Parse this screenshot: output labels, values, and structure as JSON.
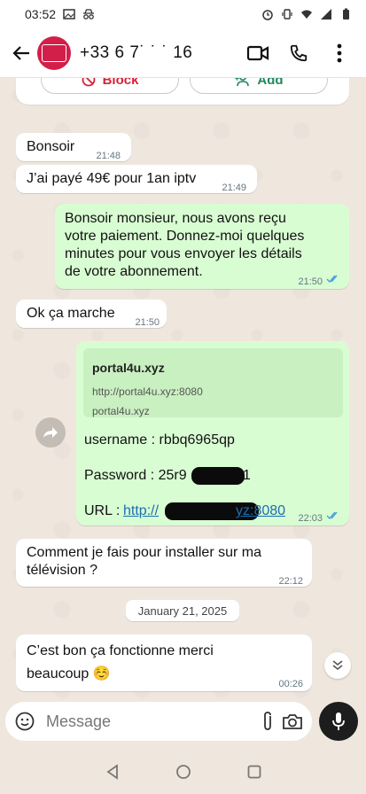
{
  "status_bar": {
    "time": "03:52"
  },
  "header": {
    "contact": "+33 6 7˙ ˙ ˙ 16"
  },
  "actions_card": {
    "block_label": "Block",
    "add_label": "Add"
  },
  "messages": [
    {
      "dir": "in",
      "text": "Bonsoir",
      "time": "21:48"
    },
    {
      "dir": "in",
      "text": "J’ai payé 49€ pour 1an iptv",
      "time": "21:49"
    },
    {
      "dir": "out",
      "lines": [
        "Bonsoir monsieur, nous avons reçu",
        "votre paiement. Donnez-moi quelques",
        "minutes pour vous envoyer les détails",
        "de votre abonnement."
      ],
      "time": "21:50"
    },
    {
      "dir": "in",
      "text": "Ok ça marche",
      "time": "21:50"
    },
    {
      "dir": "out",
      "preview": {
        "title": "portal4u.xyz",
        "url": "http://portal4u.xyz:8080",
        "host": "portal4u.xyz"
      },
      "username": "username : rbbq6965qp",
      "password_prefix": "Password : 25r9",
      "password_suffix": "1",
      "url_label": "URL : ",
      "url_start": "http://",
      "url_end": "yz:8080",
      "time": "22:03"
    },
    {
      "dir": "in",
      "lines": [
        "Comment je fais pour installer sur ma",
        "télévision ?"
      ],
      "time": "22:12"
    },
    {
      "dir": "in",
      "lines": [
        "C’est bon ça fonctionne merci",
        "beaucoup ☺️"
      ],
      "time": "00:26"
    }
  ],
  "date_separator": "January 21, 2025",
  "composer": {
    "placeholder": "Message"
  },
  "icons": [
    "back-arrow-icon",
    "video-call-icon",
    "voice-call-icon",
    "more-vert-icon",
    "block-icon",
    "add-contact-icon",
    "forward-icon",
    "chevron-down-icon",
    "sticker-icon",
    "attach-icon",
    "camera-icon",
    "mic-icon"
  ],
  "colors": {
    "outgoing": "#d9fdd3",
    "incoming": "#ffffff",
    "wallpaper": "#efe7de",
    "link": "#1a6fb0",
    "ticks": "#4fa3d9"
  }
}
